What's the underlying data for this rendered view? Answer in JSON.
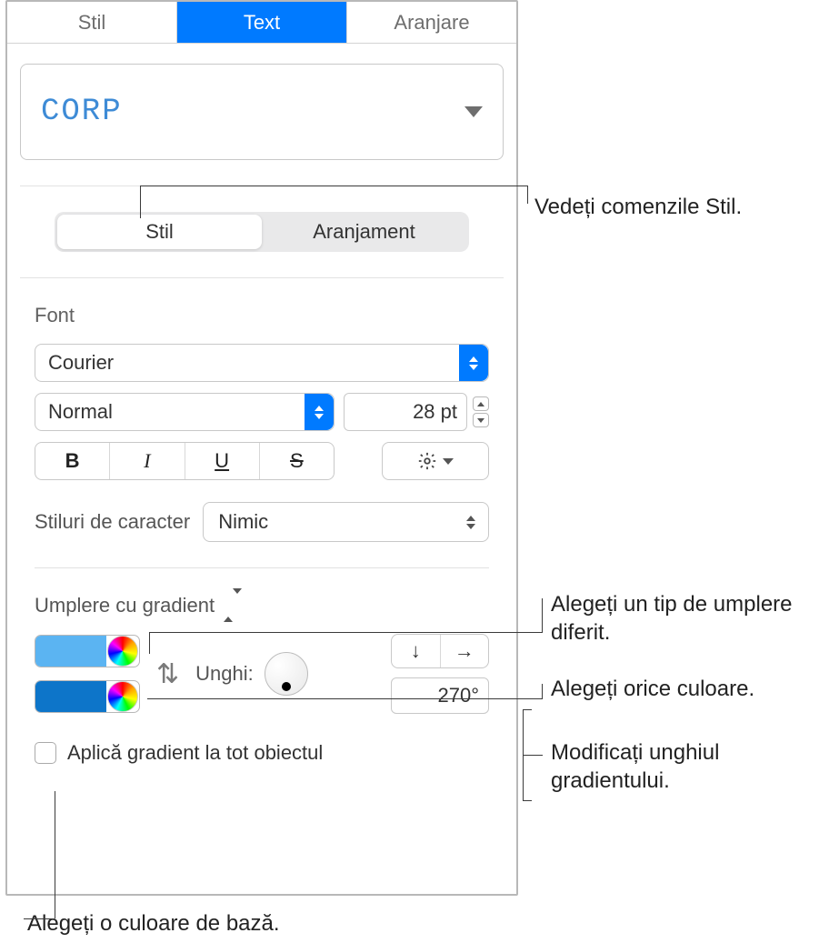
{
  "tabs": {
    "style": "Stil",
    "text": "Text",
    "arrange": "Aranjare"
  },
  "paragraph_style": "CORP",
  "segment": {
    "style": "Stil",
    "arrangement": "Aranjament"
  },
  "font": {
    "section_label": "Font",
    "family": "Courier",
    "typeface": "Normal",
    "size": "28 pt",
    "bold": "B",
    "italic": "I",
    "underline": "U",
    "strike": "S"
  },
  "char_styles": {
    "label": "Stiluri de caracter",
    "value": "Nimic"
  },
  "fill": {
    "type_label": "Umplere cu gradient",
    "stop1_color": "#5bb4f2",
    "stop2_color": "#0d75c9",
    "angle_label": "Unghi:",
    "angle_value": "270°",
    "dir_down": "↓",
    "dir_right": "→",
    "apply_checkbox": "Aplică gradient la tot obiectul"
  },
  "callouts": {
    "see_style": "Vedeți comenzile Stil.",
    "fill_type": "Alegeți un tip de umplere diferit.",
    "any_color": "Alegeți orice culoare.",
    "angle": "Modificați unghiul gradientului.",
    "base_color": "Alegeți o culoare de bază."
  }
}
